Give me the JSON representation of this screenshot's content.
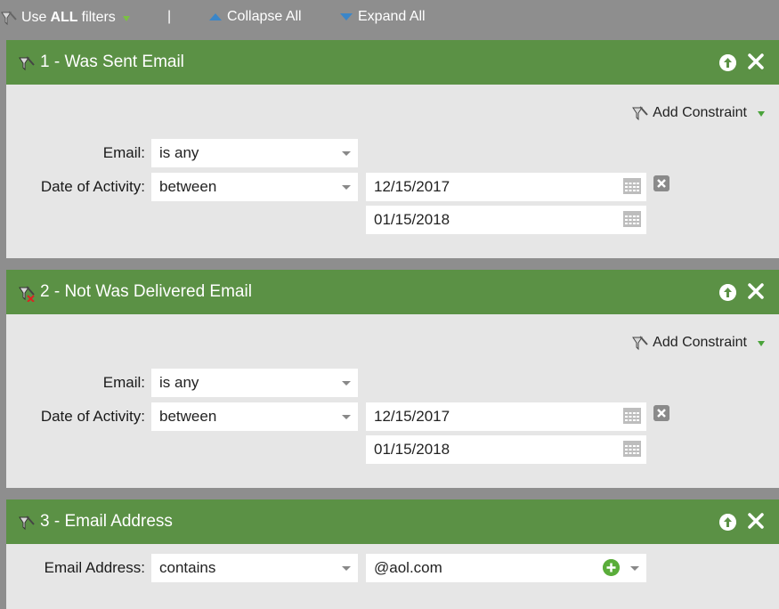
{
  "toolbar": {
    "use_label": "Use",
    "all_label": "ALL",
    "filters_label": "filters",
    "separator": "|",
    "collapse_label": "Collapse All",
    "expand_label": "Expand All"
  },
  "filters": [
    {
      "title": "1 - Was Sent Email",
      "add_constraint": "Add Constraint",
      "email_label": "Email:",
      "email_value": "is any",
      "date_label": "Date of Activity:",
      "date_operator": "between",
      "date_from": "12/15/2017",
      "date_to": "01/15/2018"
    },
    {
      "title": "2 - Not Was Delivered Email",
      "add_constraint": "Add Constraint",
      "email_label": "Email:",
      "email_value": "is any",
      "date_label": "Date of Activity:",
      "date_operator": "between",
      "date_from": "12/15/2017",
      "date_to": "01/15/2018"
    },
    {
      "title": "3 - Email Address",
      "address_label": "Email Address:",
      "address_operator": "contains",
      "address_value": "@aol.com"
    }
  ],
  "colors": {
    "header_green": "#5b9145",
    "panel_bg": "#e6e6e6",
    "page_bg": "#8e8e8e",
    "accent_blue": "#3b86c8",
    "plus_green": "#5aad3a"
  }
}
